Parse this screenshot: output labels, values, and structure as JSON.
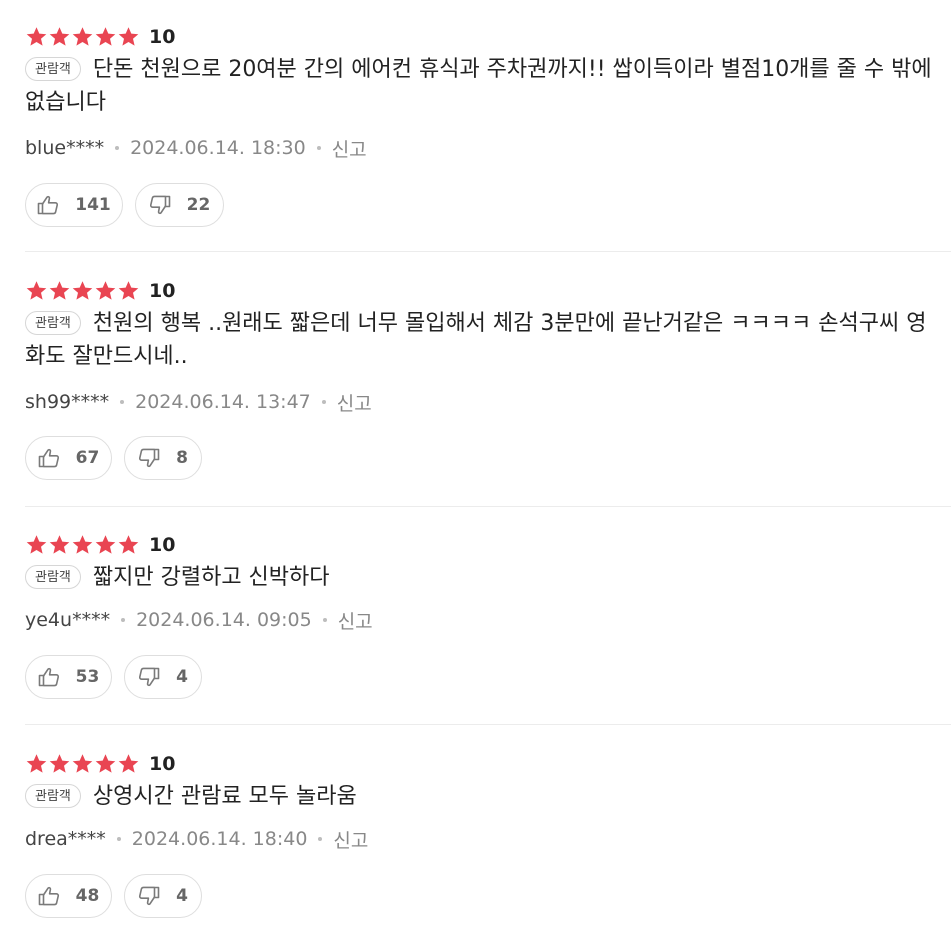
{
  "colors": {
    "star": "#e94552",
    "divider": "#ececec",
    "text": "#222222",
    "meta": "#888888"
  },
  "icons": {
    "star": "star-icon",
    "like": "thumbs-up-icon",
    "dislike": "thumbs-down-icon"
  },
  "reviews": [
    {
      "stars": 5,
      "score": "10",
      "badge": "관람객",
      "comment": "단돈 천원으로 20여분 간의 에어컨 휴식과 주차권까지!! 쌉이득이라 별점10개를 줄 수 밖에 없습니다",
      "user": "blue****",
      "date": "2024.06.14. 18:30",
      "report": "신고",
      "likes": "141",
      "dislikes": "22"
    },
    {
      "stars": 5,
      "score": "10",
      "badge": "관람객",
      "comment": "천원의 행복 ..원래도 짧은데 너무 몰입해서 체감 3분만에 끝난거같은 ㅋㅋㅋㅋ 손석구씨 영화도 잘만드시네..",
      "user": "sh99****",
      "date": "2024.06.14. 13:47",
      "report": "신고",
      "likes": "67",
      "dislikes": "8"
    },
    {
      "stars": 5,
      "score": "10",
      "badge": "관람객",
      "comment": "짧지만 강렬하고 신박하다",
      "user": "ye4u****",
      "date": "2024.06.14. 09:05",
      "report": "신고",
      "likes": "53",
      "dislikes": "4"
    },
    {
      "stars": 5,
      "score": "10",
      "badge": "관람객",
      "comment": "상영시간 관람료 모두 놀라움",
      "user": "drea****",
      "date": "2024.06.14. 18:40",
      "report": "신고",
      "likes": "48",
      "dislikes": "4"
    }
  ]
}
